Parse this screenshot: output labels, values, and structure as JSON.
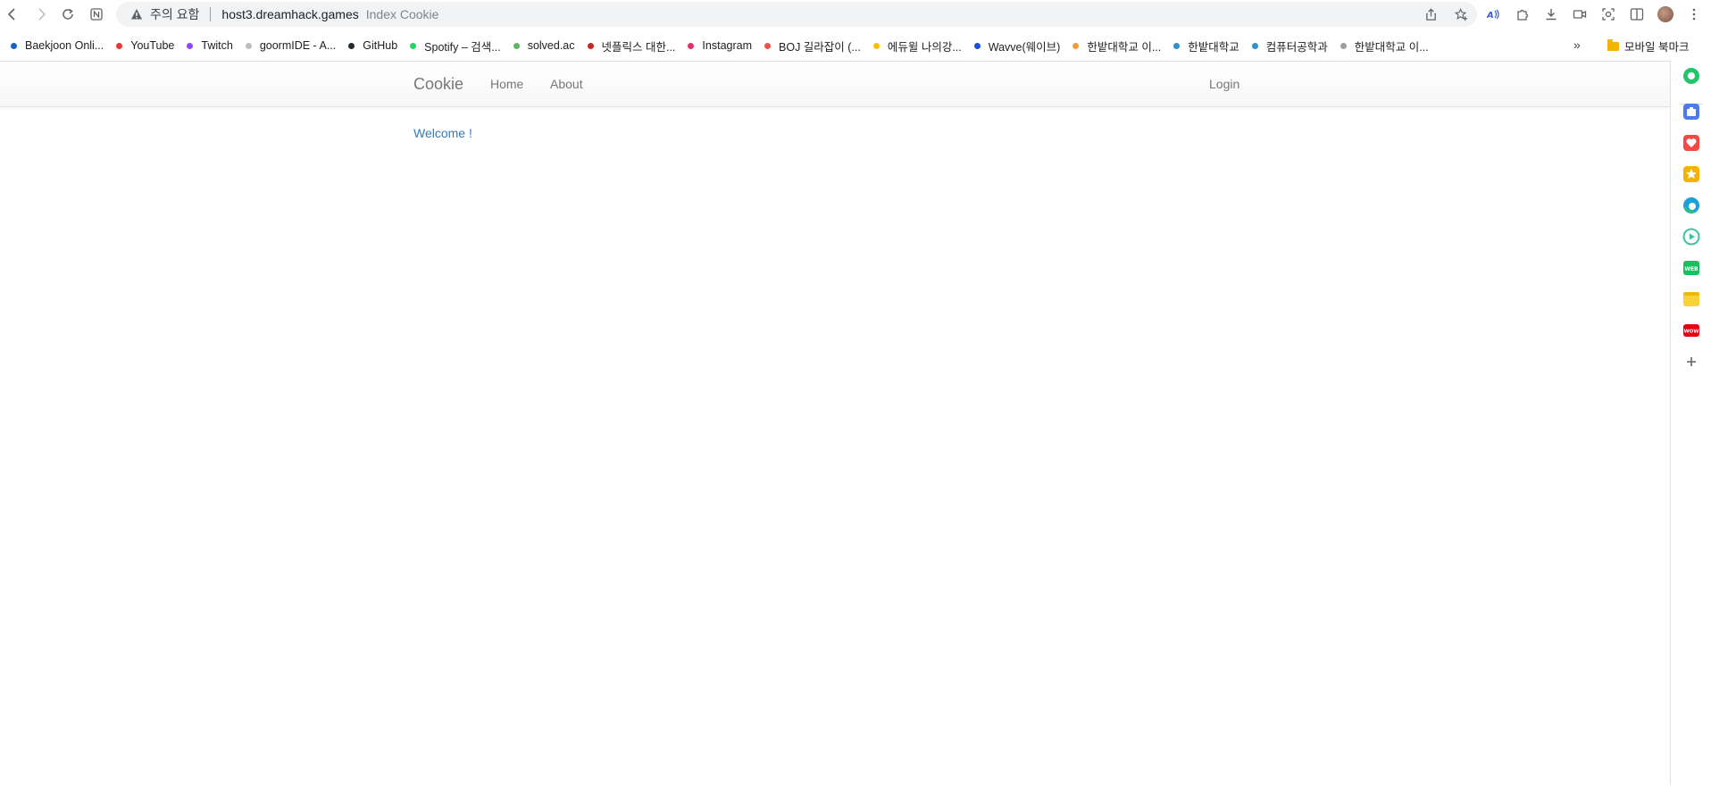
{
  "browser": {
    "omnibox": {
      "security_status": "주의 요함",
      "url": "host3.dreamhack.games",
      "page_title": "Index Cookie"
    },
    "bookmarks": [
      {
        "label": "Baekjoon Onli...",
        "color": "#1565c0"
      },
      {
        "label": "YouTube",
        "color": "#e53935"
      },
      {
        "label": "Twitch",
        "color": "#9146ff"
      },
      {
        "label": "goormIDE - A...",
        "color": "#bdbdbd"
      },
      {
        "label": "GitHub",
        "color": "#24292e"
      },
      {
        "label": "Spotify – 검색...",
        "color": "#1ed760"
      },
      {
        "label": "solved.ac",
        "color": "#5cb85c"
      },
      {
        "label": "넷플릭스 대한...",
        "color": "#c62828"
      },
      {
        "label": "Instagram",
        "color": "#e1306c"
      },
      {
        "label": "BOJ 길라잡이 (...",
        "color": "#ef5350"
      },
      {
        "label": "에듀윌 나의강...",
        "color": "#f9c000"
      },
      {
        "label": "Wavve(웨이브)",
        "color": "#1a4de0"
      },
      {
        "label": "한밭대학교 이...",
        "color": "#f39c34"
      },
      {
        "label": "한밭대학교",
        "color": "#2f8fc7"
      },
      {
        "label": "컴퓨터공학과",
        "color": "#2f8fc7"
      },
      {
        "label": "한밭대학교 이...",
        "color": "#9e9e9e"
      }
    ],
    "bookmarks_overflow": "»",
    "mobile_bookmarks": "모바일 북마크"
  },
  "page": {
    "brand": "Cookie",
    "nav": {
      "home": "Home",
      "about": "About",
      "login": "Login"
    },
    "welcome": "Welcome !",
    "link_color": "#337ab7"
  },
  "side_panel": [
    {
      "icon": "circle-app-icon",
      "color": "#21c56b"
    },
    {
      "icon": "briefcase-icon",
      "color": "#4a7de8"
    },
    {
      "icon": "heart-icon",
      "color": "#f24b45"
    },
    {
      "icon": "star-icon",
      "color": "#f5b300"
    },
    {
      "icon": "edge-icon",
      "color": "#1aa1d8"
    },
    {
      "icon": "play-icon",
      "color": "#39c5a0"
    },
    {
      "icon": "webtoon-icon",
      "color": "#16c25f"
    },
    {
      "icon": "notes-icon",
      "color": "#f7d23b"
    },
    {
      "icon": "wow-icon",
      "color": "#e60012"
    },
    {
      "icon": "add-icon",
      "color": "#5f6368"
    }
  ]
}
